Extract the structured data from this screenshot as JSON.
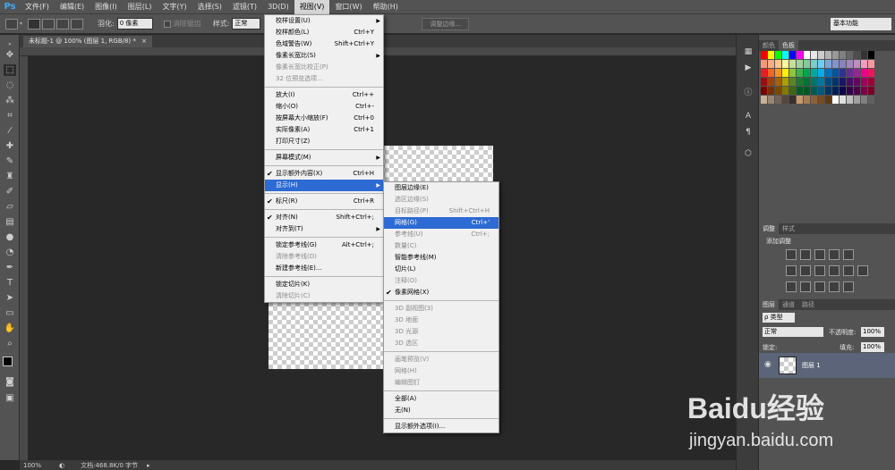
{
  "app": {
    "logo": "Ps"
  },
  "menubar": {
    "items": [
      "文件(F)",
      "编辑(E)",
      "图像(I)",
      "图层(L)",
      "文字(Y)",
      "选择(S)",
      "滤镜(T)",
      "3D(D)",
      "视图(V)",
      "窗口(W)",
      "帮助(H)"
    ],
    "active_index": 8
  },
  "options": {
    "feather_label": "羽化:",
    "feather_value": "0 像素",
    "antialias_label": "消除锯齿",
    "style_label": "样式:",
    "style_value": "正常",
    "refine_edge": "调整边缘...",
    "workspace": "基本功能"
  },
  "document": {
    "tab": "未标题-1 @ 100% (图层 1, RGB/8) *"
  },
  "status": {
    "zoom": "100%",
    "doc_info": "文档:468.8K/0 字节"
  },
  "view_menu": [
    {
      "label": "校样设置(U)",
      "shortcut": "",
      "arrow": true
    },
    {
      "label": "校样颜色(L)",
      "shortcut": "Ctrl+Y"
    },
    {
      "label": "色域警告(W)",
      "shortcut": "Shift+Ctrl+Y"
    },
    {
      "label": "像素长宽比(S)",
      "shortcut": "",
      "arrow": true
    },
    {
      "label": "像素长宽比校正(P)",
      "shortcut": "",
      "disabled": true
    },
    {
      "label": "32 位预览选项...",
      "shortcut": "",
      "disabled": true
    },
    {
      "sep": true
    },
    {
      "label": "放大(I)",
      "shortcut": "Ctrl++"
    },
    {
      "label": "缩小(O)",
      "shortcut": "Ctrl+-"
    },
    {
      "label": "按屏幕大小缩放(F)",
      "shortcut": "Ctrl+0"
    },
    {
      "label": "实际像素(A)",
      "shortcut": "Ctrl+1"
    },
    {
      "label": "打印尺寸(Z)",
      "shortcut": ""
    },
    {
      "sep": true
    },
    {
      "label": "屏幕模式(M)",
      "shortcut": "",
      "arrow": true
    },
    {
      "sep": true
    },
    {
      "label": "显示额外内容(X)",
      "shortcut": "Ctrl+H",
      "check": true
    },
    {
      "label": "显示(H)",
      "shortcut": "",
      "arrow": true,
      "highlight": true
    },
    {
      "sep": true
    },
    {
      "label": "标尺(R)",
      "shortcut": "Ctrl+R",
      "check": true
    },
    {
      "sep": true
    },
    {
      "label": "对齐(N)",
      "shortcut": "Shift+Ctrl+;",
      "check": true
    },
    {
      "label": "对齐到(T)",
      "shortcut": "",
      "arrow": true
    },
    {
      "sep": true
    },
    {
      "label": "锁定参考线(G)",
      "shortcut": "Alt+Ctrl+;"
    },
    {
      "label": "清除参考线(D)",
      "shortcut": "",
      "disabled": true
    },
    {
      "label": "新建参考线(E)...",
      "shortcut": ""
    },
    {
      "sep": true
    },
    {
      "label": "锁定切片(K)",
      "shortcut": ""
    },
    {
      "label": "清除切片(C)",
      "shortcut": "",
      "disabled": true
    }
  ],
  "show_menu": [
    {
      "label": "图层边缘(E)",
      "shortcut": ""
    },
    {
      "label": "选区边缘(S)",
      "shortcut": "",
      "disabled": true
    },
    {
      "label": "目标路径(P)",
      "shortcut": "Shift+Ctrl+H",
      "disabled": true
    },
    {
      "label": "网格(G)",
      "shortcut": "Ctrl+'",
      "highlight": true
    },
    {
      "label": "参考线(U)",
      "shortcut": "Ctrl+;",
      "disabled": true
    },
    {
      "label": "数量(C)",
      "shortcut": "",
      "disabled": true
    },
    {
      "label": "智能参考线(M)",
      "shortcut": ""
    },
    {
      "label": "切片(L)",
      "shortcut": ""
    },
    {
      "label": "注释(O)",
      "shortcut": "",
      "disabled": true
    },
    {
      "label": "像素网格(X)",
      "shortcut": "",
      "check": true
    },
    {
      "sep": true
    },
    {
      "label": "3D 副视图(3)",
      "shortcut": "",
      "disabled": true
    },
    {
      "label": "3D 地面",
      "shortcut": "",
      "disabled": true
    },
    {
      "label": "3D 光源",
      "shortcut": "",
      "disabled": true
    },
    {
      "label": "3D 选区",
      "shortcut": "",
      "disabled": true
    },
    {
      "sep": true
    },
    {
      "label": "画笔预览(V)",
      "shortcut": "",
      "disabled": true
    },
    {
      "label": "网格(H)",
      "shortcut": "",
      "disabled": true
    },
    {
      "label": "编辑图钉",
      "shortcut": "",
      "disabled": true
    },
    {
      "sep": true
    },
    {
      "label": "全部(A)",
      "shortcut": ""
    },
    {
      "label": "无(N)",
      "shortcut": ""
    },
    {
      "sep": true
    },
    {
      "label": "显示额外选项(I)...",
      "shortcut": ""
    }
  ],
  "panels": {
    "color_tabs": [
      "颜色",
      "色板"
    ],
    "adjust_tabs": [
      "调整",
      "样式"
    ],
    "adjust_title": "添加调整",
    "layers_tabs": [
      "图层",
      "通道",
      "路径"
    ],
    "kind_label": "ρ 类型",
    "blend_mode": "正常",
    "opacity_label": "不透明度:",
    "opacity_value": "100%",
    "lock_label": "锁定:",
    "fill_label": "填充:",
    "fill_value": "100%",
    "layer_name": "图层 1"
  },
  "watermark": {
    "brand": "Baidu经验",
    "url": "jingyan.baidu.com"
  },
  "colors": {
    "highlight": "#2d6ad3",
    "layer_selected": "#5b6478",
    "ps_blue": "#3fa9f5"
  }
}
